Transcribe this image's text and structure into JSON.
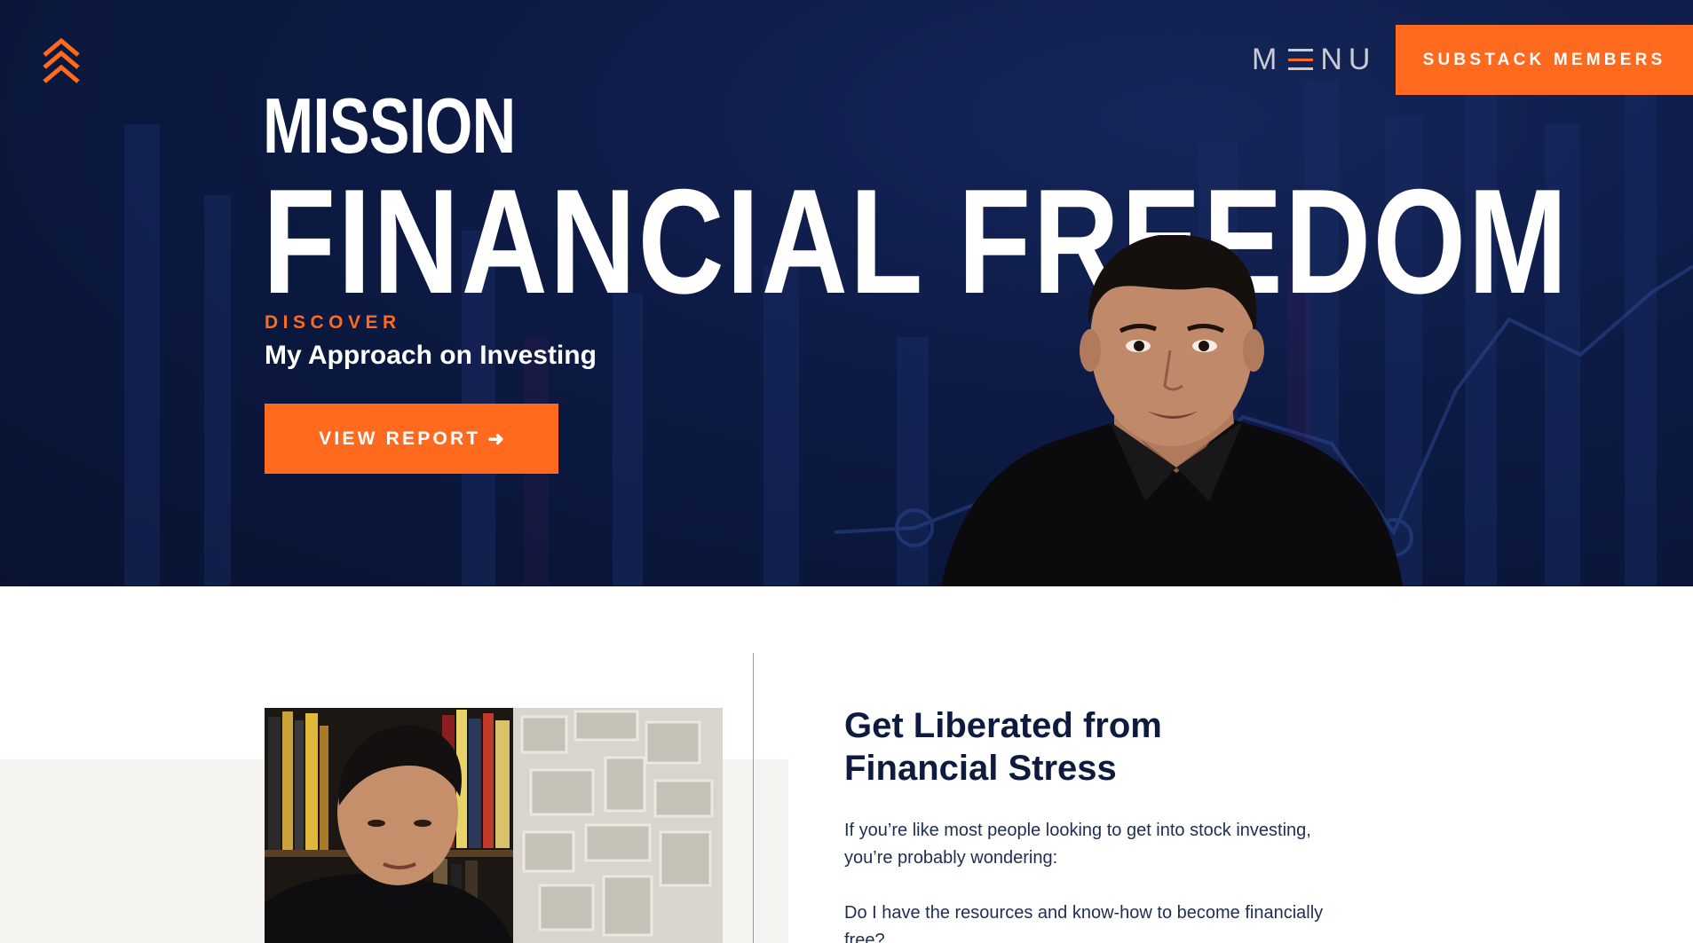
{
  "header": {
    "menu_label_m": "M",
    "menu_label_rest": "NU",
    "cta_label": "SUBSTACK MEMBERS"
  },
  "hero": {
    "title_line1": "MISSION",
    "title_line2": "FINANCIAL FREEDOM",
    "eyebrow": "DISCOVER",
    "subtitle": "My Approach on Investing",
    "button_label": "VIEW REPORT",
    "button_icon": "arrow-right-icon"
  },
  "intro": {
    "heading_line1": "Get Liberated from",
    "heading_line2": "Financial Stress",
    "paragraph1": "If you’re like most people looking to get into stock investing, you’re probably wondering:",
    "paragraph2": "Do I have the resources and know-how to become financially free?"
  },
  "colors": {
    "accent": "#ff6a1f",
    "hero_bg": "#0c1a44",
    "heading_text": "#0e1a3e"
  }
}
